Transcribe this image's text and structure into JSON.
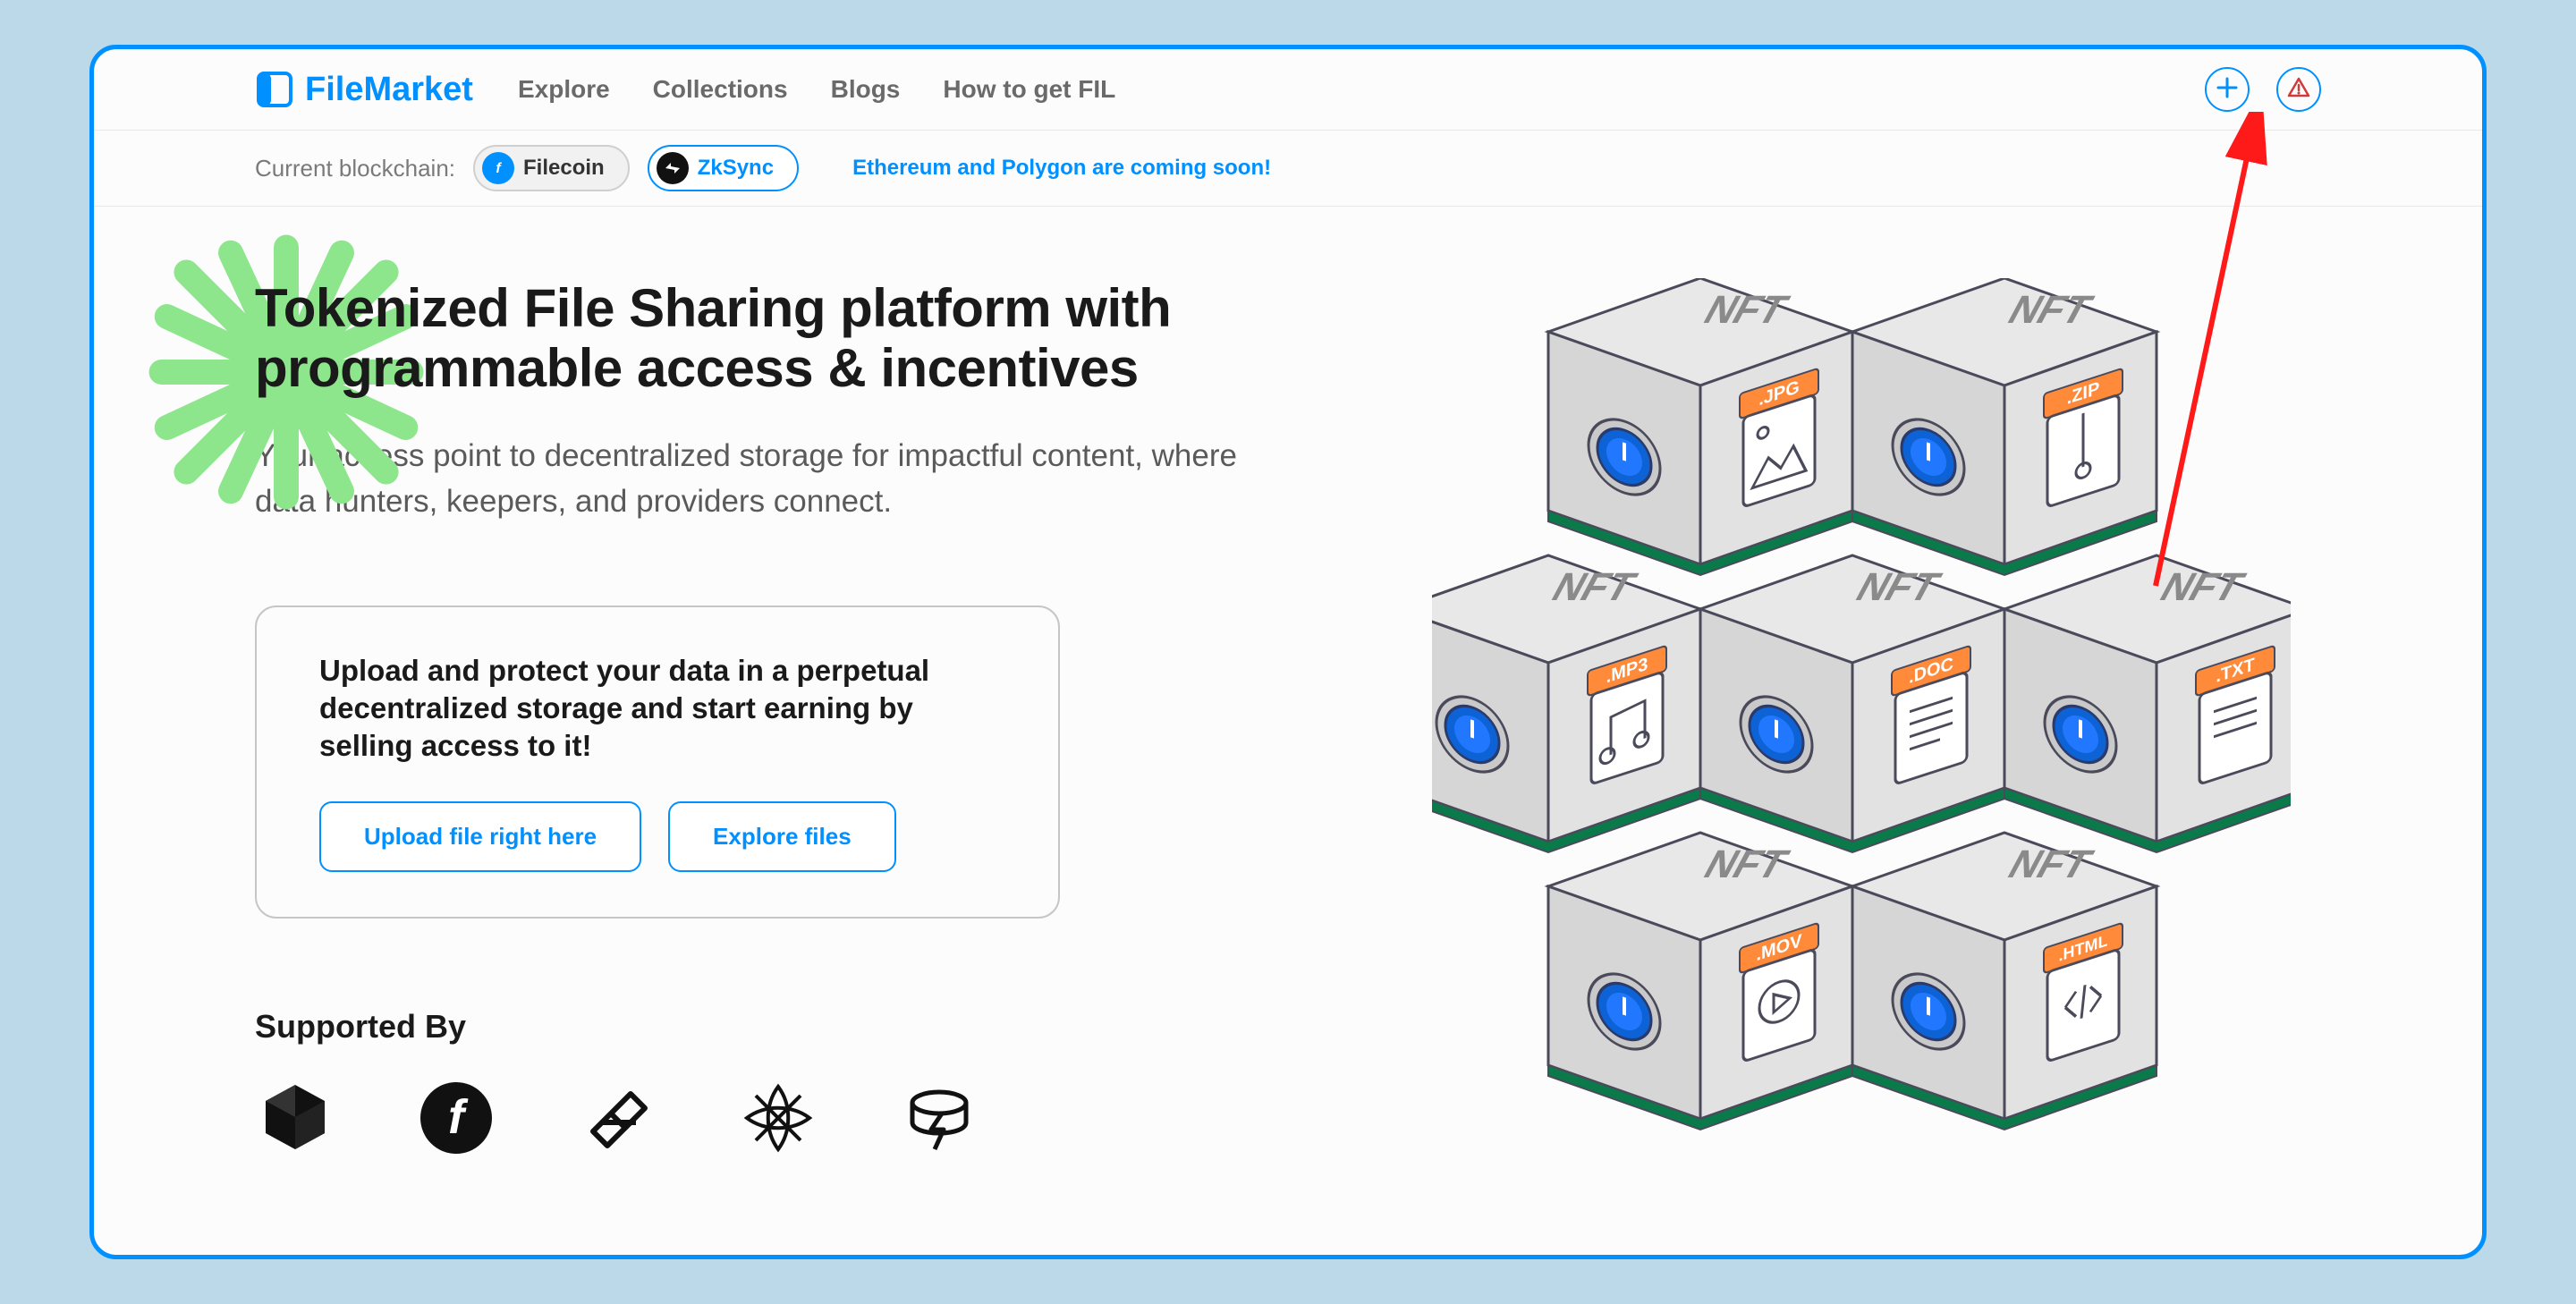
{
  "brand": {
    "name": "FileMarket"
  },
  "nav": {
    "explore": "Explore",
    "collections": "Collections",
    "blogs": "Blogs",
    "how_to_get_fil": "How to get FIL"
  },
  "subnav": {
    "label": "Current blockchain:",
    "filecoin": "Filecoin",
    "zksync": "ZkSync",
    "coming_soon": "Ethereum and Polygon are coming soon!"
  },
  "hero": {
    "title_line1": "Tokenized File Sharing platform with",
    "title_line2": "programmable access & incentives",
    "subtitle": "Your access point to decentralized storage for impactful content, where data hunters, keepers, and providers connect."
  },
  "action": {
    "title": "Upload and protect your data in a perpetual decentralized storage and start earning by selling access to it!",
    "upload_btn": "Upload file right here",
    "explore_btn": "Explore files"
  },
  "supported": {
    "title": "Supported By"
  },
  "cubes": {
    "nft": "NFT",
    "jpg": ".JPG",
    "zip": ".ZIP",
    "mp3": ".MP3",
    "doc": ".DOC",
    "txt": ".TXT",
    "mov": ".MOV",
    "html": ".HTML"
  }
}
